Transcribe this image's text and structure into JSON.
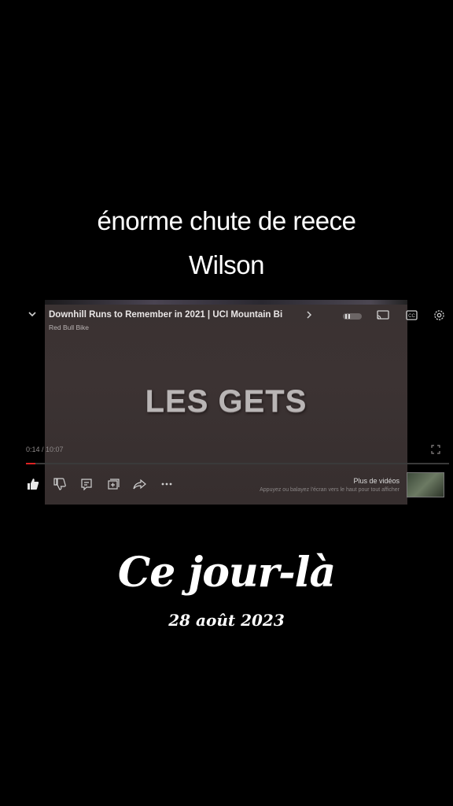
{
  "overlay": {
    "caption_line1": "énorme chute de reece",
    "caption_line2": "Wilson",
    "big_title": "Ce jour-là",
    "date": "28 août 2023"
  },
  "player": {
    "video_title": "Downhill Runs to Remember in 2021 | UCI Mountain Bi",
    "channel": "Red Bull Bike",
    "center_text": "LES GETS",
    "time": "0:14 / 10:07",
    "progress": 0.023,
    "more_videos_title": "Plus de vidéos",
    "more_videos_hint": "Appuyez ou balayez l'écran vers le haut pour tout afficher",
    "icons": [
      "chevron-down-icon",
      "chevron-right-icon",
      "pause-toggle-icon",
      "cast-icon",
      "captions-icon",
      "gear-icon",
      "fullscreen-icon",
      "like-icon",
      "dislike-icon",
      "comment-icon",
      "save-icon",
      "share-icon",
      "more-icon"
    ]
  }
}
